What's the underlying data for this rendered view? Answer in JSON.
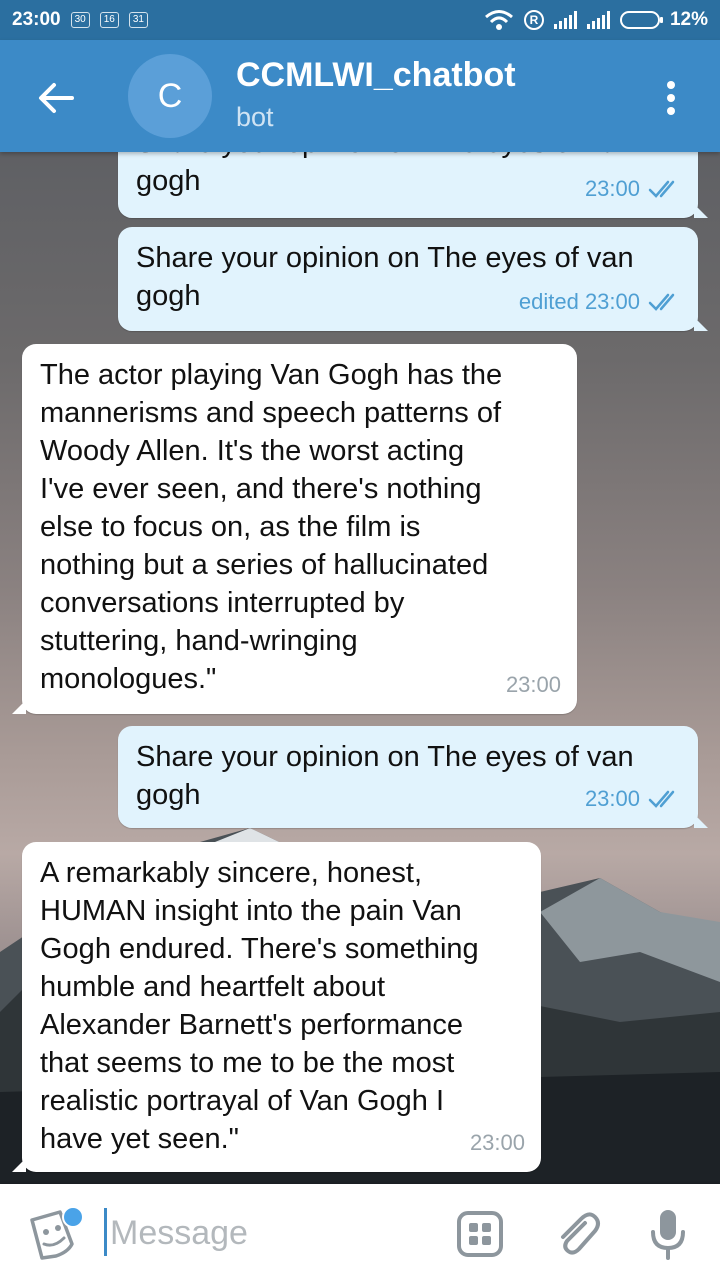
{
  "status_bar": {
    "time": "23:00",
    "badges": [
      "30",
      "16",
      "31"
    ],
    "registered_mark": "R",
    "battery": "12%"
  },
  "header": {
    "avatar_letter": "C",
    "title": "CCMLWI_chatbot",
    "subtitle": "bot"
  },
  "messages": [
    {
      "dir": "out",
      "lines": [
        "Share your opinion on The eyes of van",
        "gogh"
      ],
      "meta": "23:00",
      "read": true
    },
    {
      "dir": "out",
      "lines": [
        "Share your opinion on The eyes of van",
        "gogh"
      ],
      "meta": "edited 23:00",
      "read": true
    },
    {
      "dir": "in",
      "lines": [
        "The actor playing Van Gogh has the",
        "mannerisms and speech patterns of",
        "Woody Allen. It's the worst acting",
        "I've ever seen, and there's nothing",
        "else to focus on, as the film is",
        "nothing but a series of hallucinated",
        "conversations interrupted by",
        "stuttering, hand-wringing",
        "monologues.\""
      ],
      "meta": "23:00"
    },
    {
      "dir": "out",
      "lines": [
        "Share your opinion on The eyes of van",
        "gogh"
      ],
      "meta": "23:00",
      "read": true
    },
    {
      "dir": "in",
      "lines": [
        "A remarkably sincere, honest,",
        "HUMAN insight into the pain Van",
        "Gogh endured. There's something",
        "humble and heartfelt about",
        "Alexander Barnett's performance",
        "that seems to me to be the most",
        "realistic portrayal of Van Gogh I",
        "have yet seen.\""
      ],
      "meta": "23:00"
    }
  ],
  "input": {
    "placeholder": "Message",
    "value": ""
  },
  "icons": {
    "back": "arrow-left-icon",
    "menu": "more-vertical-icon",
    "emoji": "sticker-emoji-icon",
    "bot_commands": "bot-keyboard-icon",
    "attach": "paperclip-icon",
    "mic": "microphone-icon",
    "read_receipt": "double-check-icon"
  },
  "colors": {
    "header": "#3c8ac7",
    "status_bar": "#2b6fa0",
    "outgoing_bubble": "#e1f3fd",
    "incoming_bubble": "#ffffff",
    "accent": "#4f9fd3"
  }
}
